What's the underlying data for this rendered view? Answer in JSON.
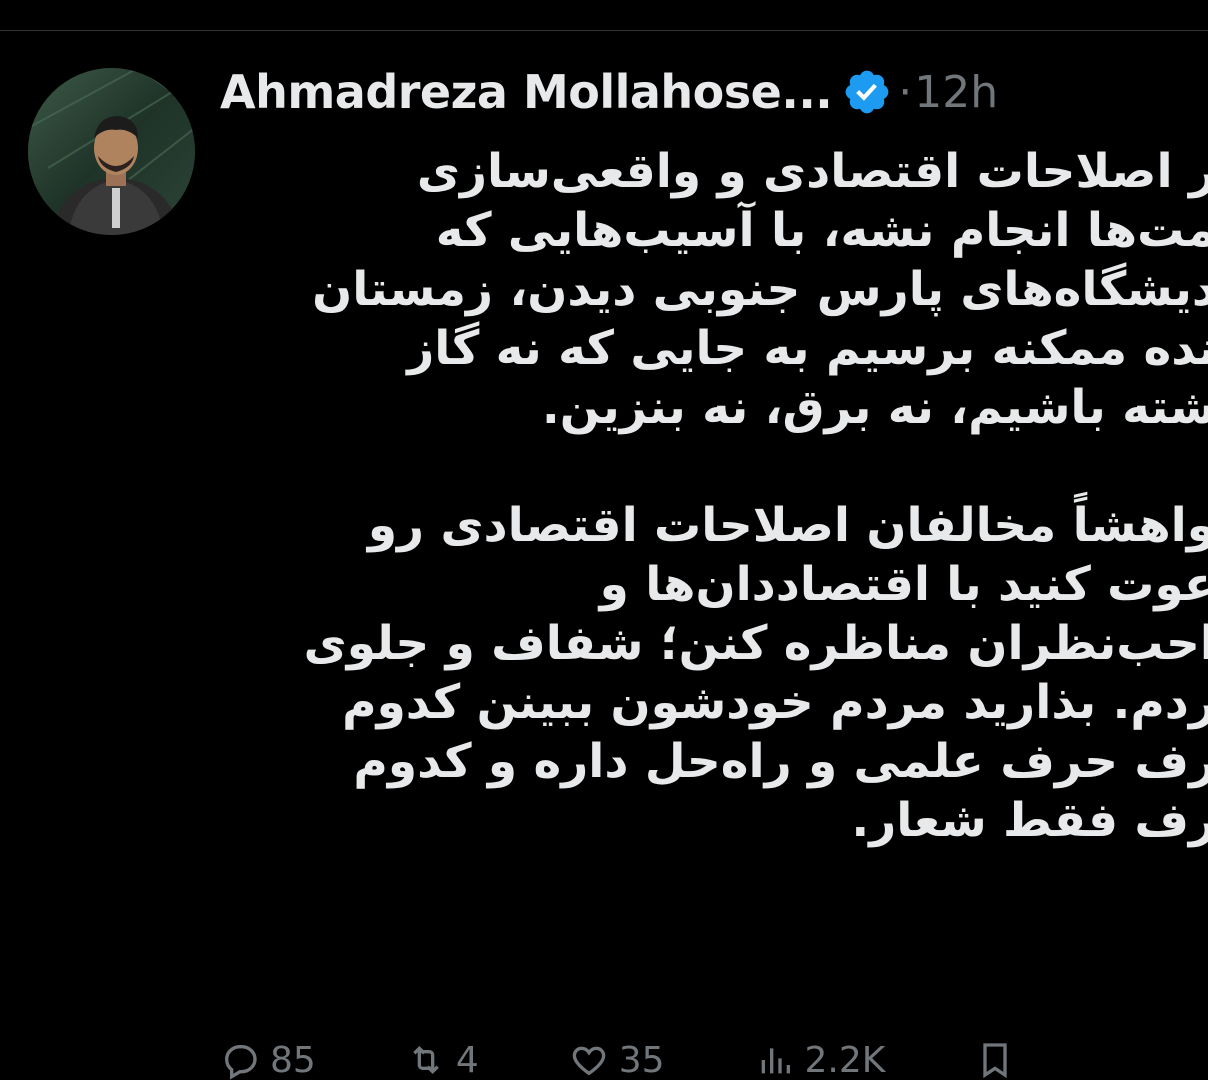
{
  "tweet": {
    "author": {
      "name": "Ahmadreza Mollahose...",
      "verified": true,
      "verified_color": "#1d9bf0"
    },
    "separator": "·",
    "time": "12h",
    "text_lines": [
      "ر اصلاحات اقتصادی و واقعی‌سازی",
      "مت‌ها انجام نشه، با آسیب‌هایی که",
      "دیشگاه‌های پارس جنوبی دیدن، زمستان",
      "نده ممکنه برسیم به جایی که نه گاز",
      "شته باشیم، نه برق، نه بنزین.",
      "",
      "واهشاً مخالفان اصلاحات اقتصادی رو",
      "عوت کنید با اقتصاددان‌ها و",
      "احب‌نظران مناظره کنن؛ شفاف و جلوی",
      "ردم. بذارید مردم خودشون ببینن کدوم",
      "رف حرف علمی و راه‌حل داره و کدوم",
      "رف فقط شعار."
    ],
    "actions": [
      {
        "icon": "reply-icon",
        "count": "85"
      },
      {
        "icon": "retweet-icon",
        "count": "4"
      },
      {
        "icon": "like-icon",
        "count": "35"
      },
      {
        "icon": "views-icon",
        "count": "2.2K"
      },
      {
        "icon": "bookmark-icon",
        "count": ""
      }
    ]
  },
  "colors": {
    "background": "#000000",
    "text": "#e7e9ea",
    "muted": "#71767b",
    "divider": "#2f3336"
  }
}
